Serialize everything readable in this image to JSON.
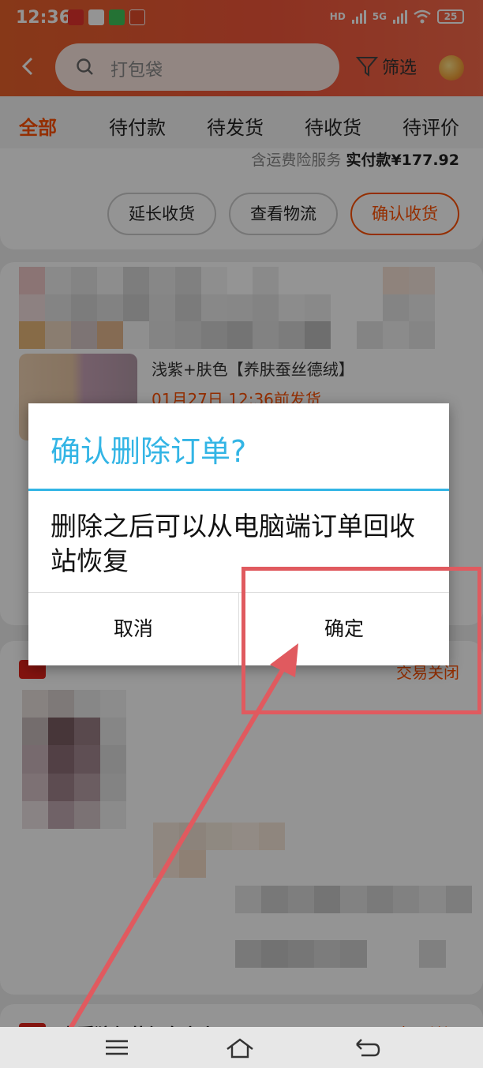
{
  "status_bar": {
    "time": "12:36",
    "battery": "25",
    "network": "5G",
    "hd": "HD"
  },
  "header": {
    "search_placeholder": "打包袋",
    "filter_label": "筛选"
  },
  "tabs": [
    "全部",
    "待付款",
    "待发货",
    "待收货",
    "待评价"
  ],
  "order1": {
    "insurance_text": "含运费险服务",
    "paid_label": "实付款",
    "paid_amount": "¥177.92",
    "buttons": [
      "延长收货",
      "查看物流",
      "确认收货"
    ]
  },
  "order2": {
    "item_desc": "浅紫+肤色【养肤蚕丝德绒】",
    "ship_time": "01月27日 12:36前发货"
  },
  "order3": {
    "status": "交易关闭"
  },
  "order4": {
    "shop": "卡爵狼伊莎红专卖店",
    "status": "交易关闭"
  },
  "dialog": {
    "title": "确认删除订单?",
    "message": "删除之后可以从电脑端订单回收站恢复",
    "cancel": "取消",
    "confirm": "确定"
  },
  "colors": {
    "accent": "#ff5000",
    "dialog_blue": "#33b5e5",
    "annotation": "#e05a5f"
  }
}
